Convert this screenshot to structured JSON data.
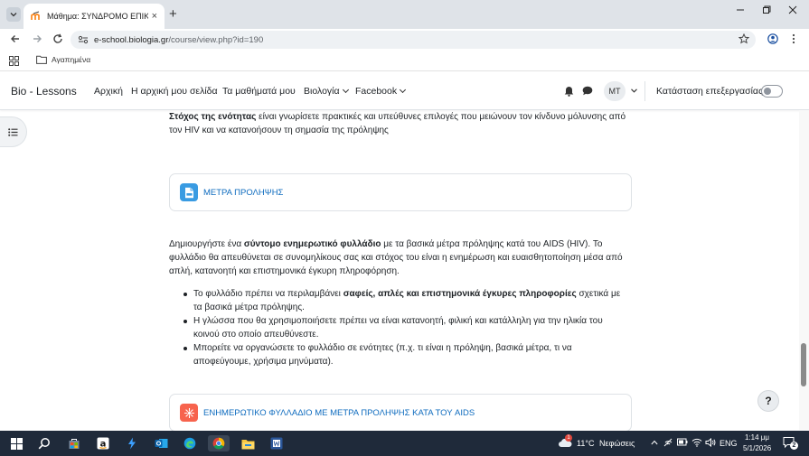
{
  "browser": {
    "tab_title": "Μάθημα: ΣΥΝΔΡΟΜΟ ΕΠΙΚΤΗ",
    "tab_close": "×",
    "new_tab": "+",
    "url_host": "e-school.biologia.gr",
    "url_path": "/course/view.php?id=190",
    "bookmark_folder": "Αγαπημένα"
  },
  "moodle_nav": {
    "brand": "Bio - Lessons",
    "items": [
      "Αρχική",
      "Η αρχική μου σελίδα",
      "Τα μαθήματά μου",
      "Βιολογία",
      "Facebook"
    ],
    "avatar_initials": "MT",
    "edit_mode_label": "Κατάσταση επεξεργασίας"
  },
  "content": {
    "goal_bold": "Στόχος της ενότητας",
    "goal_text": " είναι γνωρίσετε πρακτικές και υπεύθυνες επιλογές που μειώνουν τον κίνδυνο μόλυνσης από τον HIV και να κατανοήσουν τη σημασία της πρόληψης",
    "resource1": "ΜΕΤΡΑ ΠΡΟΛΗΨΗΣ",
    "intro_pre": "Δημιουργήστε ένα ",
    "intro_bold": "σύντομο ενημερωτικό φυλλάδιο",
    "intro_post": " με τα βασικά μέτρα πρόληψης κατά του AIDS (HIV). Το φυλλάδιο θα απευθύνεται σε συνομηλίκους σας και στόχος του είναι η ενημέρωση και ευαισθητοποίηση μέσα από απλή, κατανοητή και επιστημονικά έγκυρη πληροφόρηση.",
    "bullet1_pre": "Το φυλλάδιο πρέπει να περιλαμβάνει ",
    "bullet1_bold": "σαφείς, απλές και επιστημονικά έγκυρες πληροφορίες",
    "bullet1_post": " σχετικά με τα βασικά μέτρα πρόληψης.",
    "bullet2": "Η γλώσσα που θα χρησιμοποιήσετε πρέπει να είναι κατανοητή, φιλική και κατάλληλη για την ηλικία του κοινού στο οποίο απευθύνεστε.",
    "bullet3": "Μπορείτε να οργανώσετε το φυλλάδιο σε ενότητες (π.χ. τι είναι η πρόληψη, βασικά μέτρα, τι να αποφεύγουμε, χρήσιμα μηνύματα).",
    "resource2": "ΕΝΗΜΕΡΩΤΙΚΟ ΦΥΛΛΑΔΙΟ ΜΕ ΜΕΤΡΑ ΠΡΟΛΗΨΗΣ ΚΑΤΑ ΤΟΥ AIDS",
    "help": "?"
  },
  "taskbar": {
    "weather_temp": "11°C",
    "weather_desc": "Νεφώσεις",
    "weather_badge": "1",
    "lang": "ENG",
    "time": "1:14 μμ",
    "date": "5/1/2026",
    "notif_count": "2"
  },
  "colors": {
    "accent": "#0f6cbf",
    "pdf_icon": "#399be2",
    "assign_icon": "#f7634d"
  }
}
